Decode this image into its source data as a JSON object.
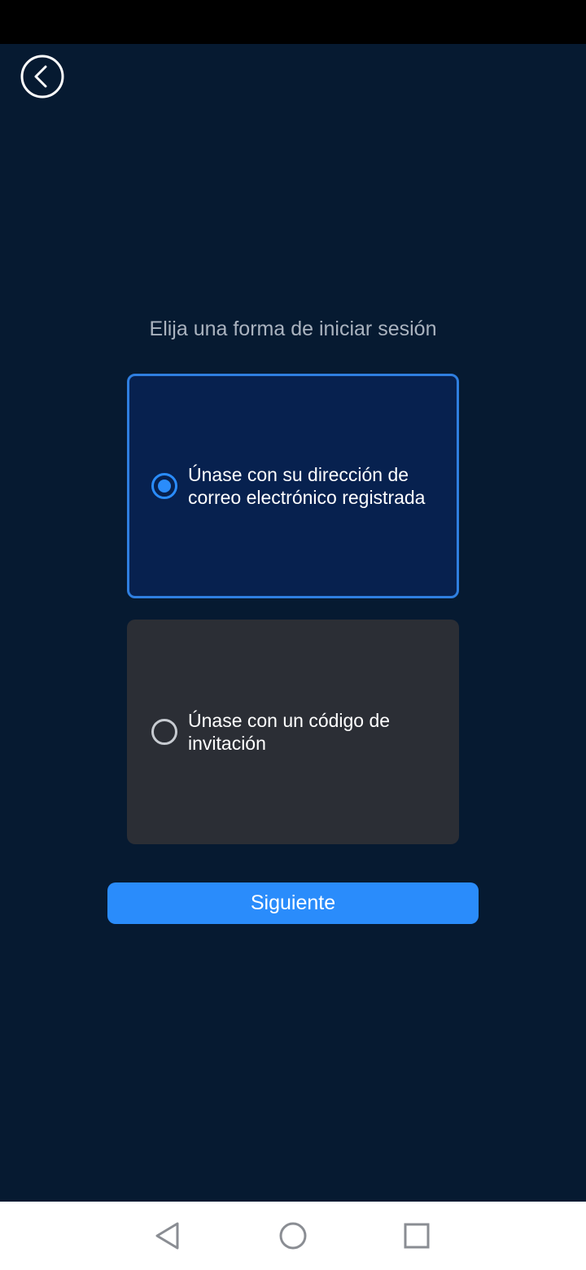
{
  "header": {
    "back_icon": "chevron-left-circle-icon"
  },
  "prompt": "Elija una forma de iniciar sesión",
  "options": [
    {
      "label": "Únase con su dirección de correo electrónico registrada",
      "selected": true
    },
    {
      "label": "Únase con un código de invitación",
      "selected": false
    }
  ],
  "next_button": {
    "label": "Siguiente"
  },
  "nav_bar": {
    "icons": [
      "back-triangle-icon",
      "home-circle-icon",
      "recents-square-icon"
    ]
  },
  "colors": {
    "background": "#061a31",
    "accent": "#2a8cfb",
    "selected_card": "#07214f",
    "selected_border": "#2f7fe0",
    "unselected_card": "#2b2e35"
  }
}
